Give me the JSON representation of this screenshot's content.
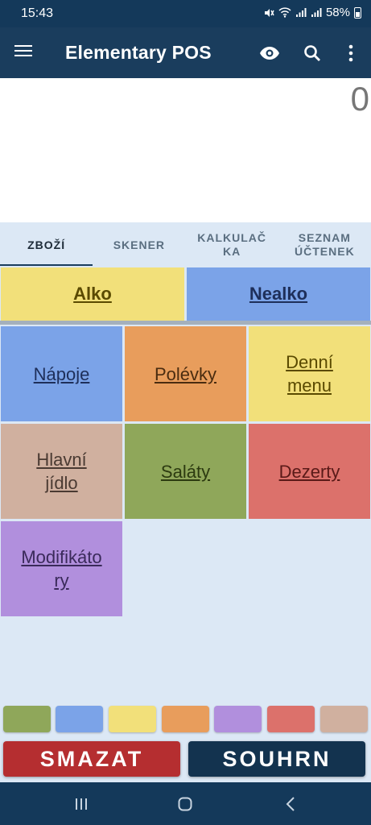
{
  "status_bar": {
    "time": "15:43",
    "battery": "58%"
  },
  "app_bar": {
    "title": "Elementary POS",
    "icons": [
      "menu-icon",
      "eye-icon",
      "search-icon",
      "more-vert-icon"
    ]
  },
  "display": {
    "value": "0"
  },
  "tabs": [
    {
      "label": "ZBOŽÍ",
      "active": true
    },
    {
      "label": "SKENER",
      "active": false
    },
    {
      "label": "KALKULAČ\nKA",
      "active": false
    },
    {
      "label": "SEZNAM\nÚČTENEK",
      "active": false
    }
  ],
  "top_categories": [
    {
      "label": "Alko",
      "color": "#f2e07a"
    },
    {
      "label": "Nealko",
      "color": "#7ba3e8"
    }
  ],
  "categories": [
    {
      "label": "Nápoje",
      "color": "#7ba3e8"
    },
    {
      "label": "Polévky",
      "color": "#e89d5c"
    },
    {
      "label": "Denní\nmenu",
      "color": "#f2e07a"
    },
    {
      "label": "Hlavní\njídlo",
      "color": "#d0b09f"
    },
    {
      "label": "Saláty",
      "color": "#8fa75a"
    },
    {
      "label": "Dezerty",
      "color": "#dc716b"
    },
    {
      "label": "Modifikáto\nry",
      "color": "#b18fdd"
    }
  ],
  "color_swatches": [
    "#8fa75a",
    "#7ba3e8",
    "#f2e07a",
    "#e89d5c",
    "#b18fdd",
    "#dc716b",
    "#d0b09f"
  ],
  "actions": {
    "smazat": {
      "label": "SMAZAT",
      "color": "#b52e30"
    },
    "souhrn": {
      "label": "SOUHRN",
      "color": "#13334f"
    }
  },
  "nav_bar": {
    "icons": [
      "recents-icon",
      "home-icon",
      "back-icon"
    ]
  }
}
